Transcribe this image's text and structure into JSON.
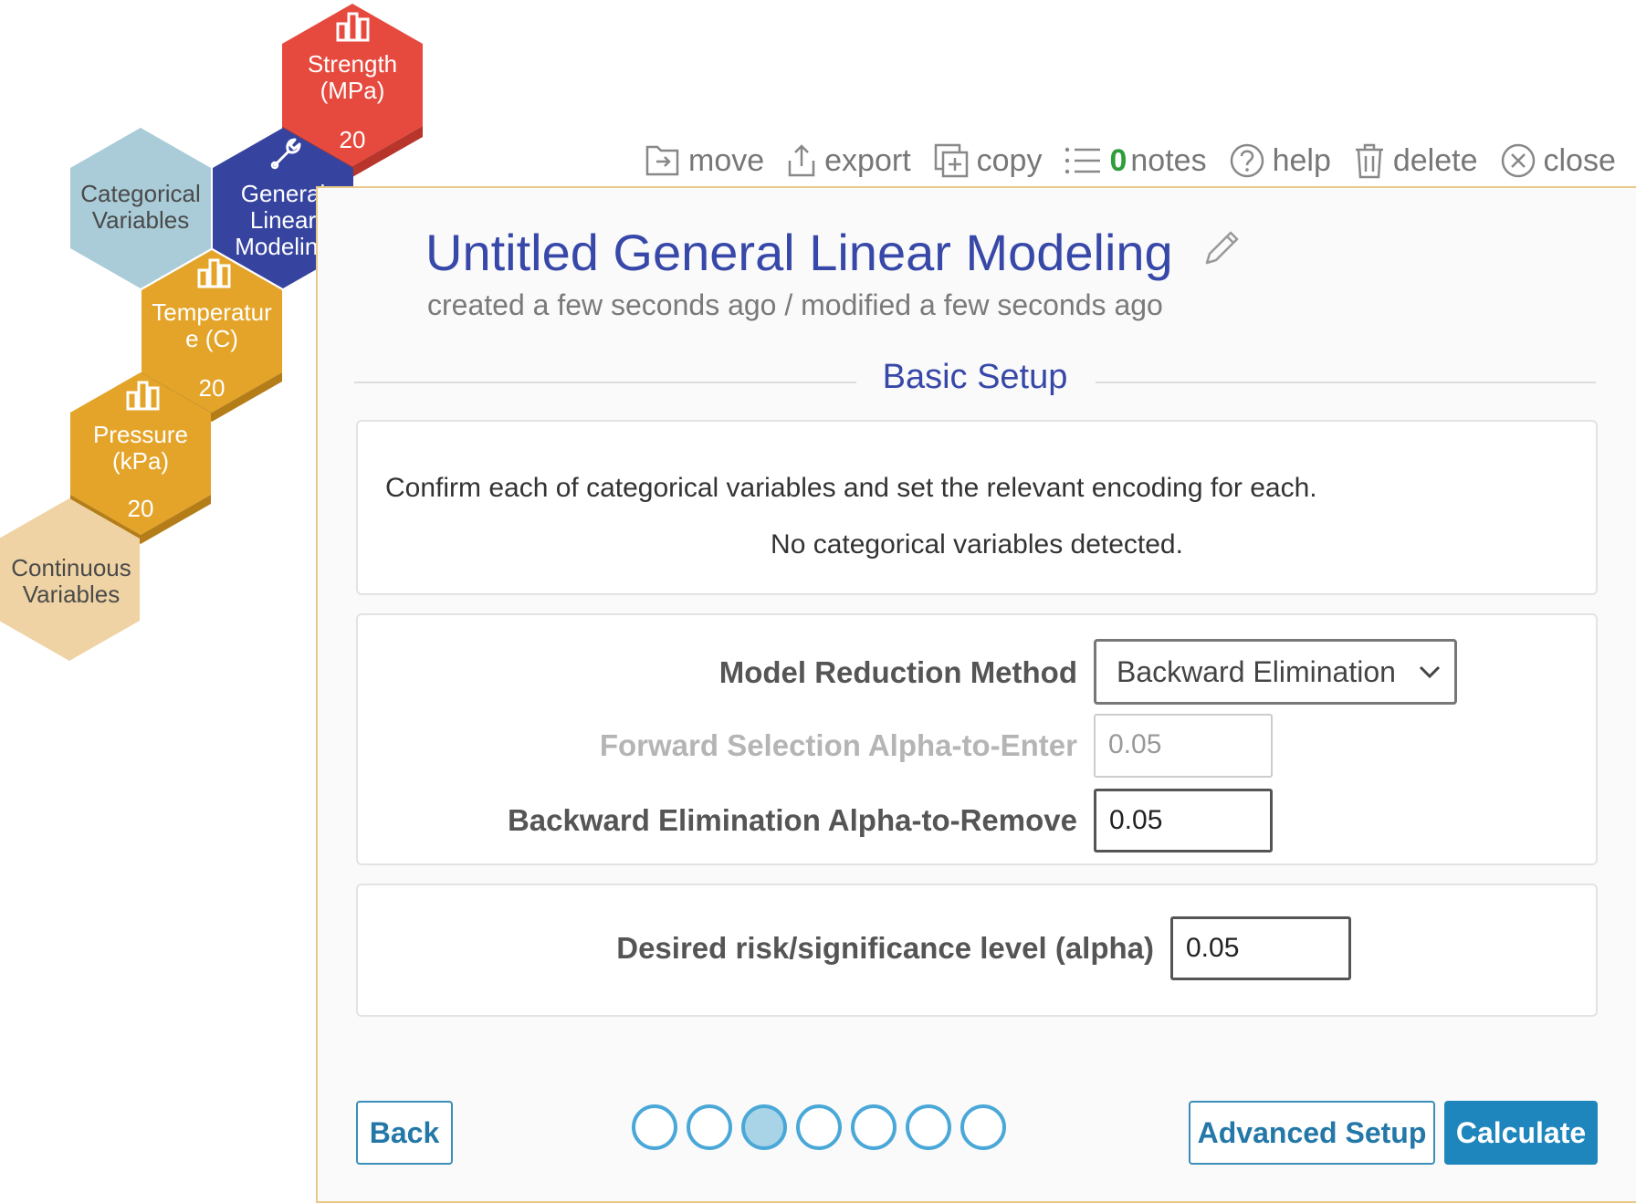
{
  "honeycomb": {
    "strength": {
      "label_line1": "Strength",
      "label_line2": "(MPa)",
      "count": "20",
      "icon": "bar-chart-icon"
    },
    "categorical": {
      "label_line1": "Categorical",
      "label_line2": "Variables"
    },
    "glm": {
      "label_line1": "General",
      "label_line2": "Linear",
      "label_line3": "Modeling",
      "icon": "wrench-icon"
    },
    "temperature": {
      "label_line1": "Temperatur",
      "label_line2": "e (C)",
      "count": "20",
      "icon": "bar-chart-icon"
    },
    "pressure": {
      "label_line1": "Pressure",
      "label_line2": "(kPa)",
      "count": "20",
      "icon": "bar-chart-icon"
    },
    "continuous": {
      "label_line1": "Continuous",
      "label_line2": "Variables"
    },
    "colors": {
      "red": "#e64a3e",
      "navy": "#3644a0",
      "light_blue": "#a9ccd8",
      "gold": "#e4a42a",
      "tan": "#efd3a4"
    }
  },
  "toolbar": {
    "move": "move",
    "export": "export",
    "copy": "copy",
    "notes_count": "0",
    "notes": "notes",
    "help": "help",
    "delete": "delete",
    "close": "close"
  },
  "header": {
    "title": "Untitled General Linear Modeling",
    "timestamp": "created a few seconds ago / modified a few seconds ago"
  },
  "section": {
    "title": "Basic Setup"
  },
  "categorical_box": {
    "instruction": "Confirm each of categorical variables and set the relevant encoding for each.",
    "empty_message": "No categorical variables detected."
  },
  "model_reduction": {
    "method_label": "Model Reduction Method",
    "method_value": "Backward Elimination",
    "forward_label": "Forward Selection Alpha-to-Enter",
    "forward_value": "0.05",
    "backward_label": "Backward Elimination Alpha-to-Remove",
    "backward_value": "0.05"
  },
  "alpha": {
    "label": "Desired risk/significance level (alpha)",
    "value": "0.05"
  },
  "footer": {
    "back": "Back",
    "advanced": "Advanced Setup",
    "calculate": "Calculate",
    "step_count": 7,
    "active_step": 3
  }
}
